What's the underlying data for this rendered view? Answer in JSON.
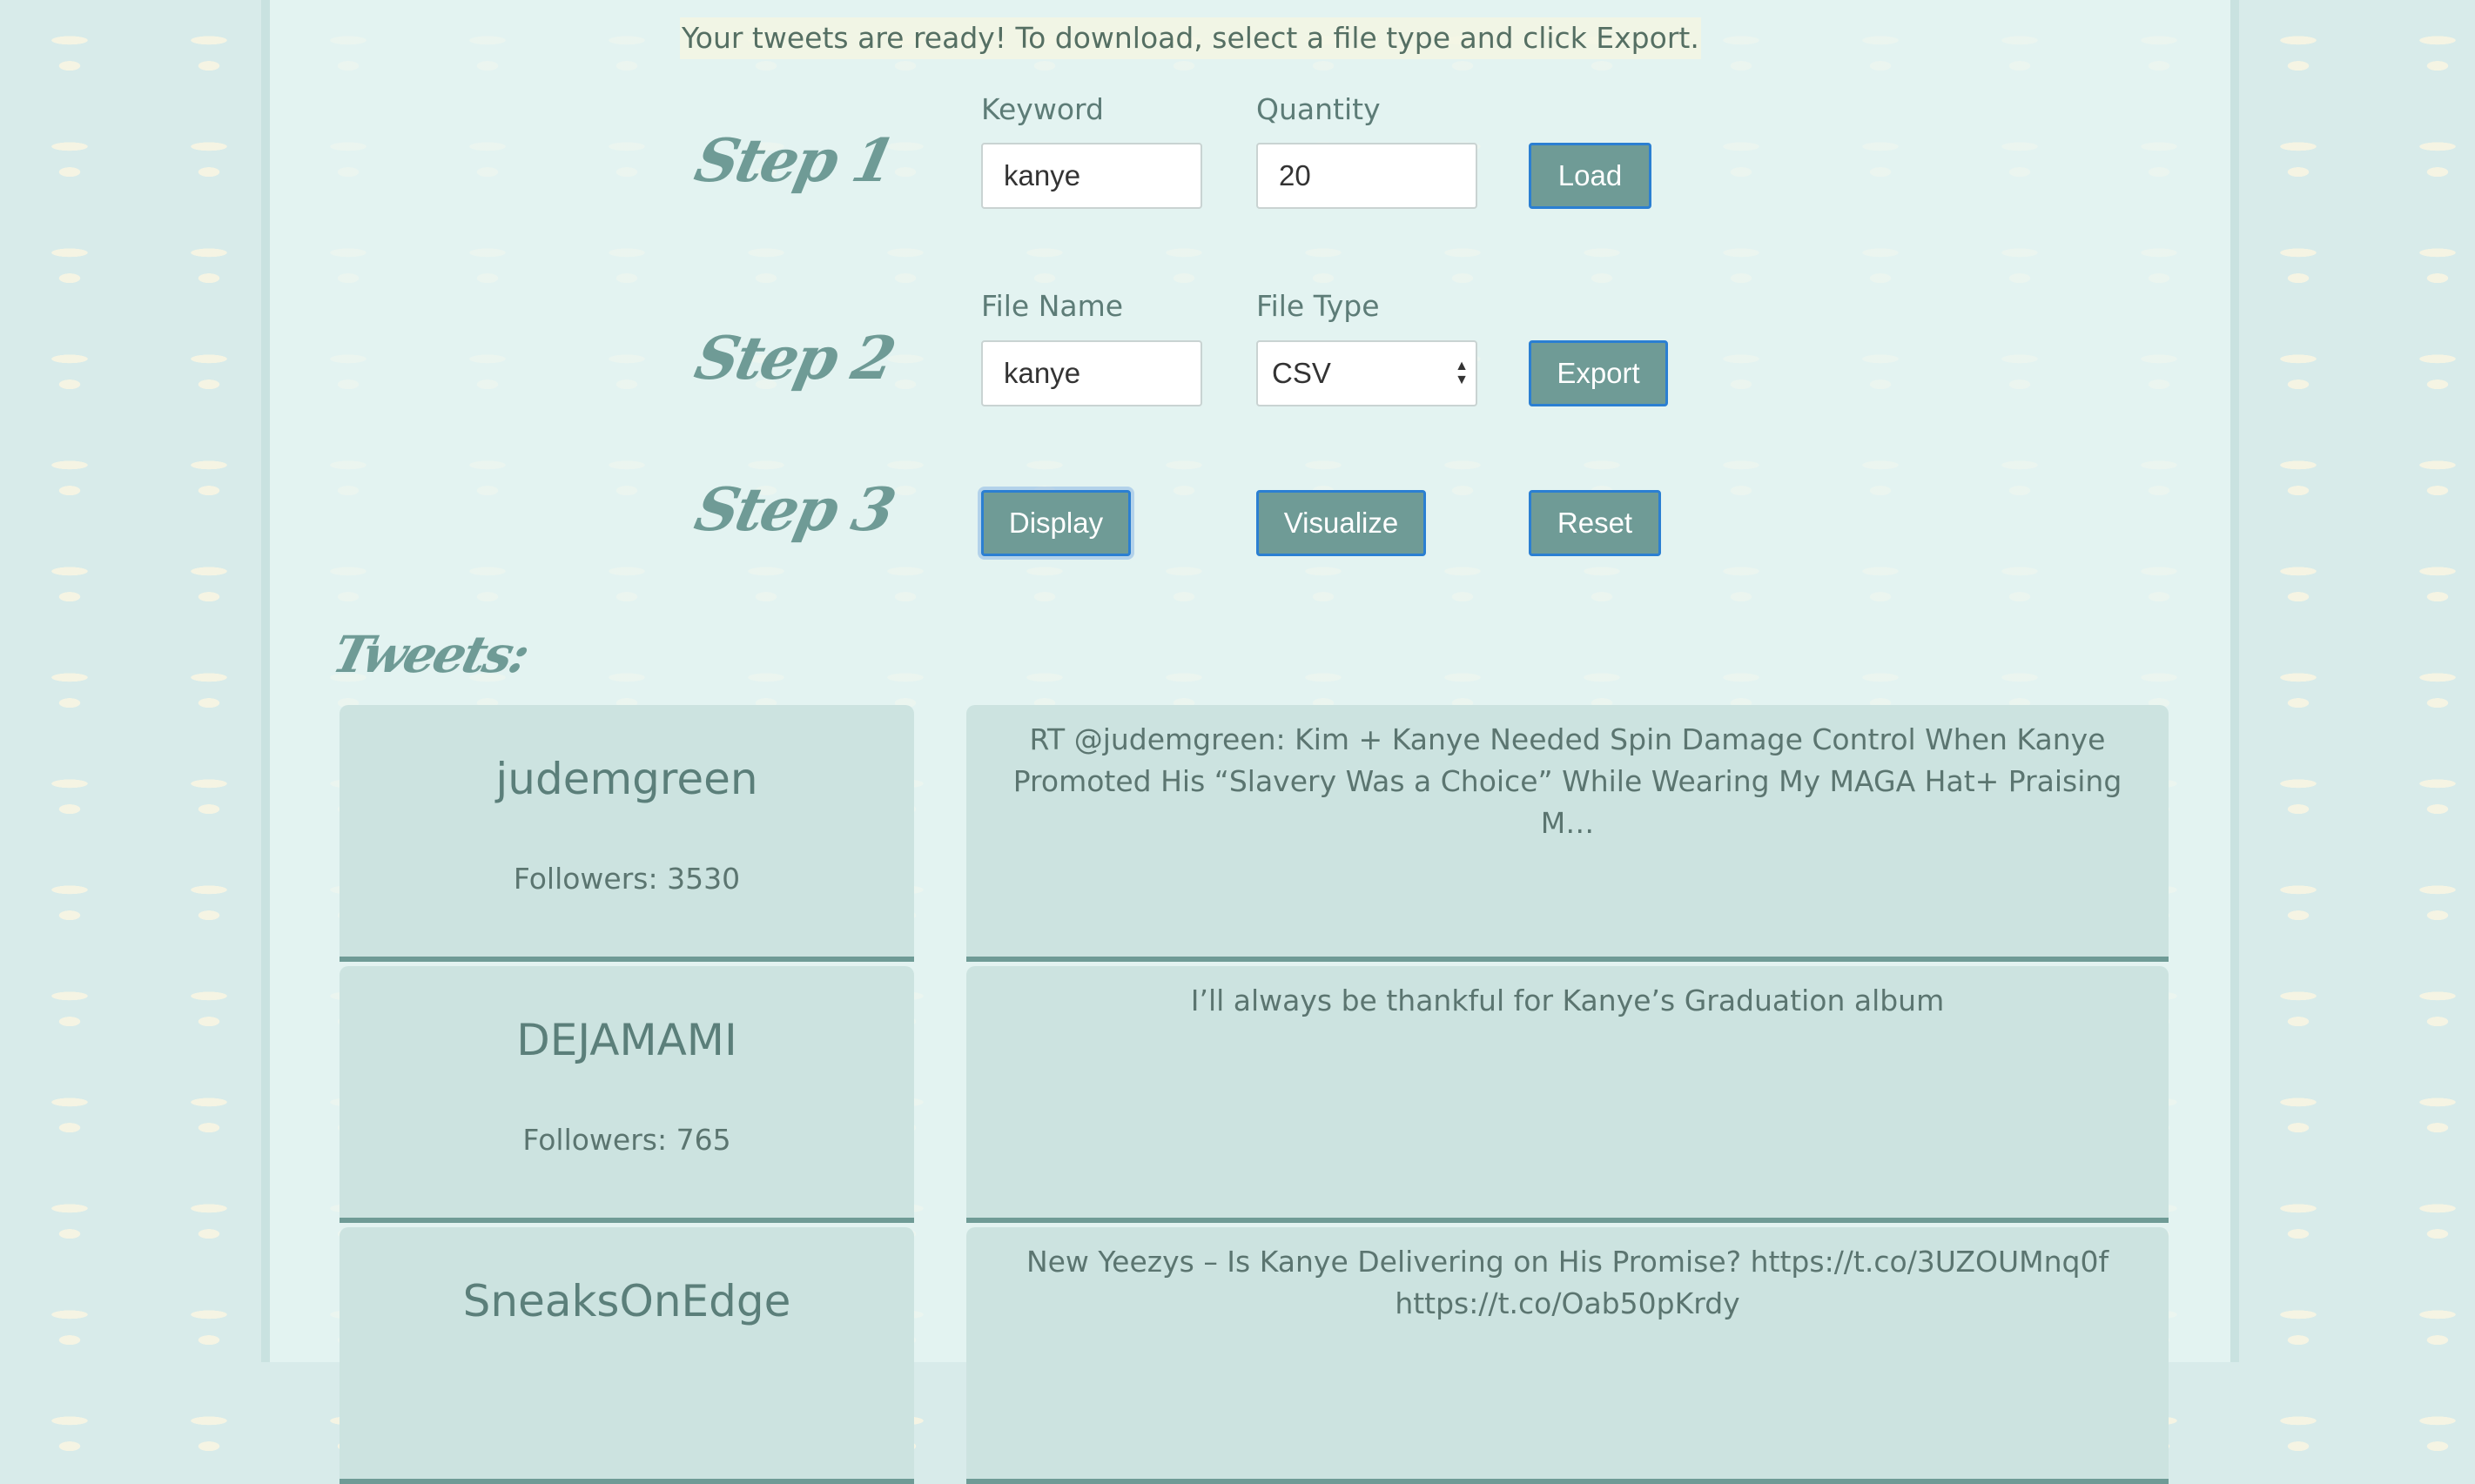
{
  "notice": "Your tweets are ready! To download, select a file type and click Export.",
  "steps": {
    "step1": {
      "label": "Step 1",
      "keyword_label": "Keyword",
      "keyword_value": "kanye",
      "quantity_label": "Quantity",
      "quantity_value": "20",
      "load_label": "Load"
    },
    "step2": {
      "label": "Step 2",
      "filename_label": "File Name",
      "filename_value": "kanye",
      "filetype_label": "File Type",
      "filetype_value": "CSV",
      "export_label": "Export"
    },
    "step3": {
      "label": "Step 3",
      "display_label": "Display",
      "visualize_label": "Visualize",
      "reset_label": "Reset"
    }
  },
  "tweets_heading": "Tweets:",
  "tweets": [
    {
      "username": "judemgreen",
      "followers": "Followers: 3530",
      "text": "RT @judemgreen: Kim + Kanye Needed Spin Damage Control When Kanye Promoted His “Slavery Was a Choice” While Wearing My MAGA Hat+ Praising M…"
    },
    {
      "username": "DEJAMAMI",
      "followers": "Followers: 765",
      "text": "I’ll always be thankful for Kanye’s Graduation album"
    },
    {
      "username": "SneaksOnEdge",
      "followers": "",
      "text": "New Yeezys – Is Kanye Delivering on His Promise? https://t.co/3UZOUMnq0f https://t.co/Oab50pKrdy"
    }
  ],
  "colors": {
    "accent": "#6f9b96",
    "button_border": "#2b7fd2",
    "card_bg": "#cce3e0",
    "page_bg": "#d8ebea"
  }
}
